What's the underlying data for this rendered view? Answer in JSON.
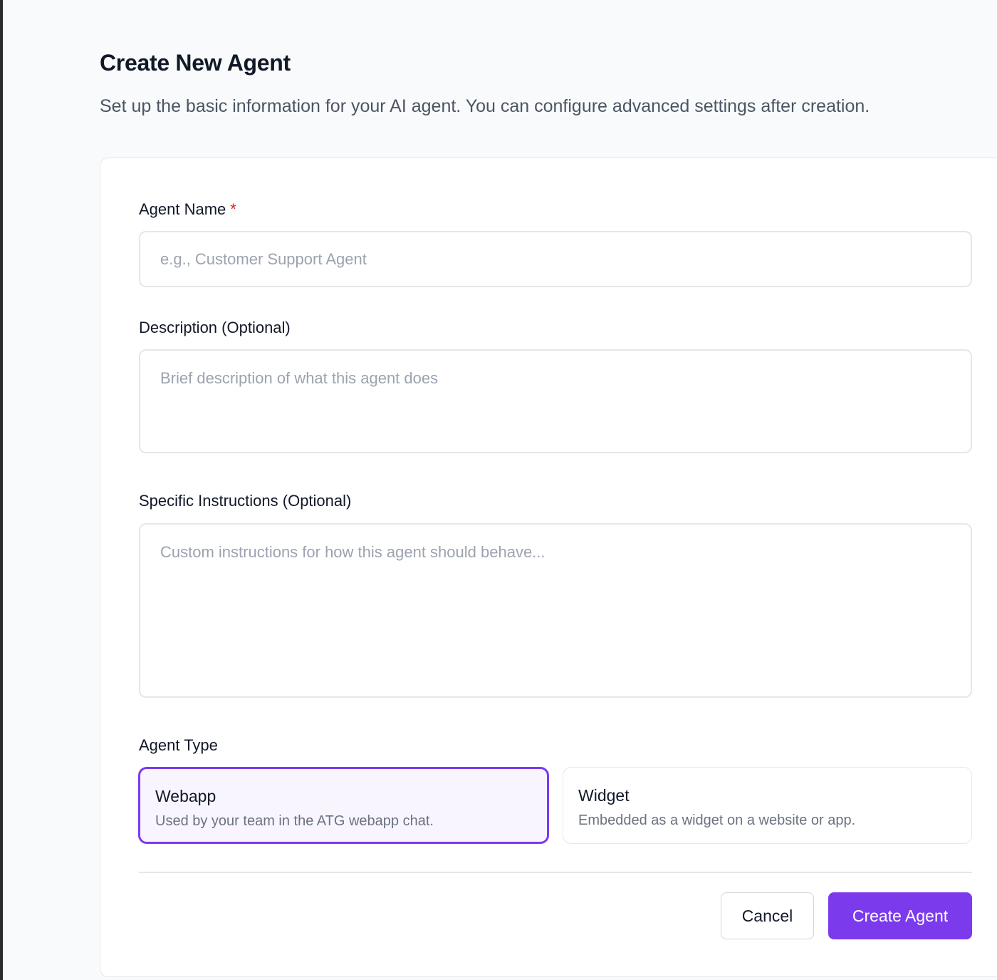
{
  "page": {
    "title": "Create New Agent",
    "subtitle": "Set up the basic information for your AI agent. You can configure advanced settings after creation."
  },
  "form": {
    "name": {
      "label": "Agent Name",
      "required_mark": "*",
      "placeholder": "e.g., Customer Support Agent",
      "value": ""
    },
    "description": {
      "label": "Description (Optional)",
      "placeholder": "Brief description of what this agent does",
      "value": ""
    },
    "instructions": {
      "label": "Specific Instructions (Optional)",
      "placeholder": "Custom instructions for how this agent should behave...",
      "value": ""
    },
    "agent_type": {
      "label": "Agent Type",
      "selected": "webapp",
      "options": [
        {
          "id": "webapp",
          "title": "Webapp",
          "description": "Used by your team in the ATG webapp chat."
        },
        {
          "id": "widget",
          "title": "Widget",
          "description": "Embedded as a widget on a website or app."
        }
      ]
    }
  },
  "actions": {
    "cancel_label": "Cancel",
    "create_label": "Create Agent"
  },
  "colors": {
    "accent": "#7c3aed",
    "required": "#dc2626",
    "selected_bg": "#f8f5fe"
  }
}
